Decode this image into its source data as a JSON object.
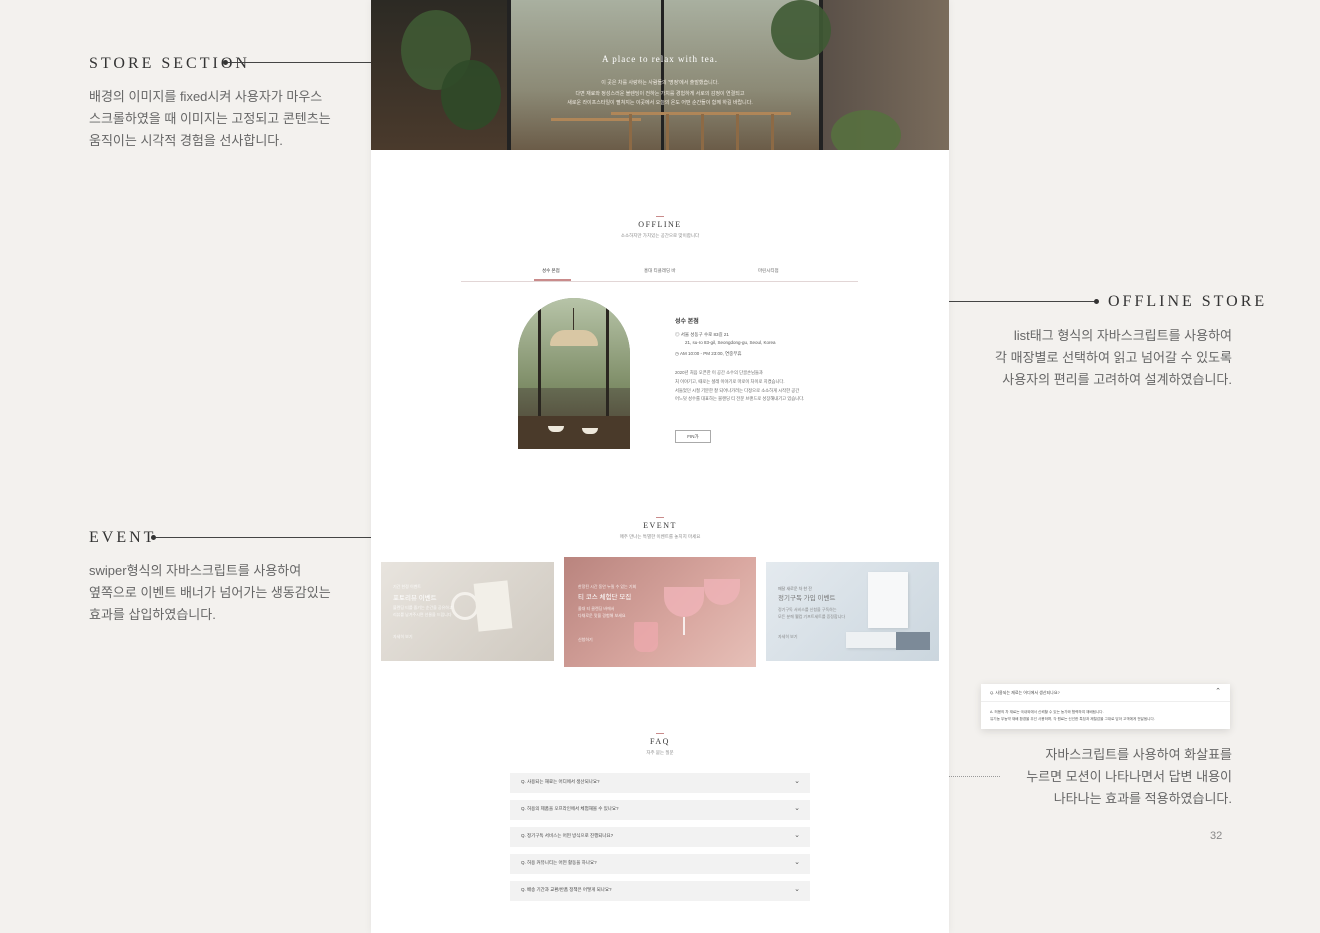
{
  "annotations": {
    "store": {
      "title": "STORE SECTION",
      "lines": [
        "배경의 이미지를 fixed시켜 사용자가 마우스",
        "스크롤하였을 때 이미지는 고정되고 콘텐츠는",
        "움직이는 시각적 경험을 선사합니다."
      ]
    },
    "offline": {
      "title": "OFFLINE STORE",
      "lines": [
        "list태그 형식의 자바스크립트를 사용하여",
        "각 매장별로 선택하여 읽고 넘어갈 수 있도록",
        "사용자의 편리를 고려하여 설계하였습니다."
      ]
    },
    "event": {
      "title": "EVENT",
      "lines": [
        "swiper형식의 자바스크립트를 사용하여",
        "옆쪽으로 이벤트 배너가 넘어가는 생동감있는",
        "효과를 삽입하였습니다."
      ]
    },
    "faq": {
      "lines": [
        "자바스크립트를 사용하여 화살표를",
        "누르면 모션이 나타나면서 답변 내용이",
        "나타나는 효과를 적용하였습니다."
      ]
    }
  },
  "hero": {
    "title": "A place to relax with tea.",
    "lines": [
      "이 곳은 차를 사랑하는 사람들의 '명정'에서 출발했습니다.",
      "다면 재료와 정성스러운 블렌딩이 전하는 가치를 경험하게 서로의 감정이 연결되고",
      "새로운 라이프스타일이 펼쳐지는 이곳에서 오늘의 온도 어떤 순간들이 함께 하길 바랍니다."
    ]
  },
  "offline": {
    "title": "OFFLINE",
    "subtitle": "소소하지만 가치있는 공간으로 맞이합니다",
    "tabs": [
      "성수 본점",
      "홍대 티클래딩 바",
      "마린시티점"
    ],
    "store": {
      "name": "성수 본점",
      "address": "서울 성동구 수로 83길 21",
      "address_en": "21, su-ro 83-gil, Seongdong-gu, Seoul, Korea",
      "hours": "AM 10:00 - PM 23:00, 연중무휴",
      "desc": [
        "2020년 처음 오픈한 이 공간 소수의 단골손님들과",
        "처 이야기고, 때로는 셜레 이야기로 마로이 차이로 지켰습니다.",
        "서들었던 시절 기분한 잘 되어나가려는 다정으로 소소하게 시작한 공간",
        "어느덧 성수를 대표하는 블랜딩 티 전문 브랜드로 성장해내기고 있습니다."
      ],
      "button": "FIN가"
    }
  },
  "event": {
    "title": "EVENT",
    "subtitle": "매주 만나는 특별한 이벤트를 놓치지 마세요",
    "cards": [
      {
        "tag": "기간 한정 이벤트",
        "title": "포토리뷰 이벤트",
        "text": [
          "블렌딩 티를 즐기는 순간을 공유하고",
          "리뷰를 남겨주시면 선물을 드립니다"
        ],
        "foot": "자세히 보기"
      },
      {
        "tag": "한정된 시간 동안 누릴 수 있는 기회",
        "title": "티 코스 체험단 모집",
        "text": [
          "올대 티 클렌딩 바에서",
          "다채로운 맛을 경험해 보세요"
        ],
        "foot": "신청하기"
      },
      {
        "tag": "매달 새로운 차 한 잔",
        "title": "정기구독 가입 이벤트",
        "text": [
          "정기구독 서비스를 신청을 구독하는",
          "모든 분께 웰컴 기프트세트를 증정합니다"
        ],
        "foot": "자세히 보기"
      }
    ]
  },
  "faq": {
    "title": "FAQ",
    "subtitle": "자주 묻는 질문",
    "items": [
      "Q. 사용되는 재료는 어디에서 생산되나요?",
      "Q. 허용의 제품을 오프라인에서 체험해볼 수 있나요?",
      "Q. 정기구독 서비스는 어떤 방식으로 진행되나요?",
      "Q. 허용 커뮤니티는 어떤 활동을 하나요?",
      "Q. 배송 기간과 교환/반품 정책은 어떻게 되나요?"
    ],
    "popup": {
      "question": "Q. 사용되는 재료는 어디에서 생산되나요?",
      "answer": [
        "A. 허용의 차 재료는 국내외에서 신뢰할 수 있는 농가와 협력하여 재배됩니다.",
        "유기농 무농약 재배 환경을 우선 사용하며, 각 원료는 신선한 특징과 제철감을 그대로 담아 고객에게 전달됩니다."
      ]
    }
  },
  "page_number": "32",
  "colors": {
    "accent": "#c98b8b",
    "background": "#f3f1ee"
  }
}
